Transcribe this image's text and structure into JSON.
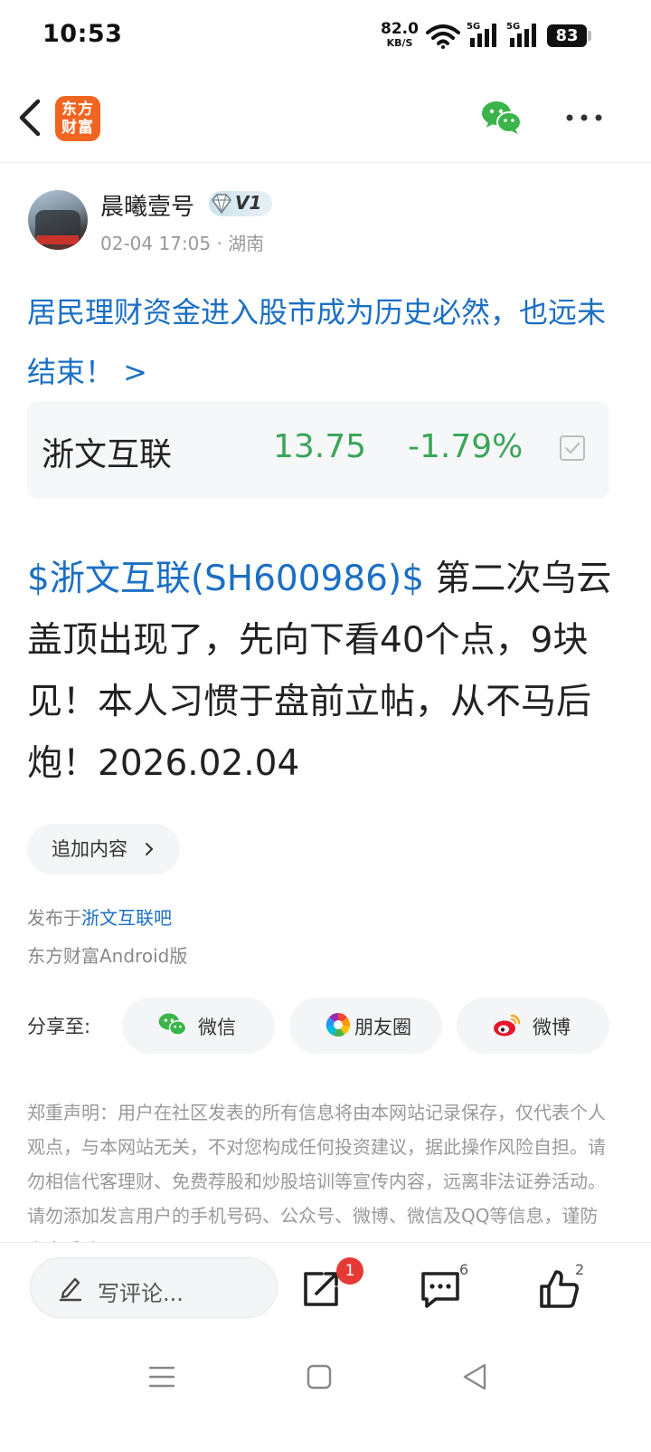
{
  "status_bar": {
    "time": "10:53",
    "net_speed_value": "82.0",
    "net_speed_unit": "KB/S",
    "signal1_label": "5G",
    "signal2_label": "5G",
    "battery": "83"
  },
  "nav": {
    "logo_line1": "东方",
    "logo_line2": "财富",
    "icons": [
      "back-icon",
      "wechat-icon",
      "more-icon"
    ]
  },
  "author": {
    "name": "晨曦壹号",
    "level": "V1",
    "time": "02-04 17:05",
    "location": "· 湖南"
  },
  "post": {
    "title": "居民理财资金进入股市成为历史必然，也远未结束！ >",
    "stock_link": "$浙文互联(SH600986)$",
    "body": " 第二次乌云盖顶出现了，先向下看40个点，9块见！本人习惯于盘前立帖，从不马后炮！2026.02.04",
    "add_content_label": "追加内容",
    "published_in_prefix": "发布于",
    "published_in_bar": "浙文互联吧",
    "client": "东方财富Android版"
  },
  "stock_card": {
    "name": "浙文互联",
    "price": "13.75",
    "change": "-1.79%",
    "color_down": "#3aa559"
  },
  "share": {
    "label": "分享至:",
    "wechat": "微信",
    "moments": "朋友圈",
    "weibo": "微博"
  },
  "disclaimer": "郑重声明：用户在社区发表的所有信息将由本网站记录保存，仅代表个人观点，与本网站无关，不对您构成任何投资建议，据此操作风险自担。请勿相信代客理财、免费荐股和炒股培训等宣传内容，远离非法证券活动。请勿添加发言用户的手机号码、公众号、微博、微信及QQ等信息，谨防上当受骗！",
  "bottom_bar": {
    "comment_placeholder": "写评论...",
    "share_badge": "1",
    "comment_count": "6",
    "like_count": "2"
  },
  "colors": {
    "link_blue": "#1b6fc3",
    "brand_orange": "#f06522",
    "badge_red": "#e53935"
  }
}
